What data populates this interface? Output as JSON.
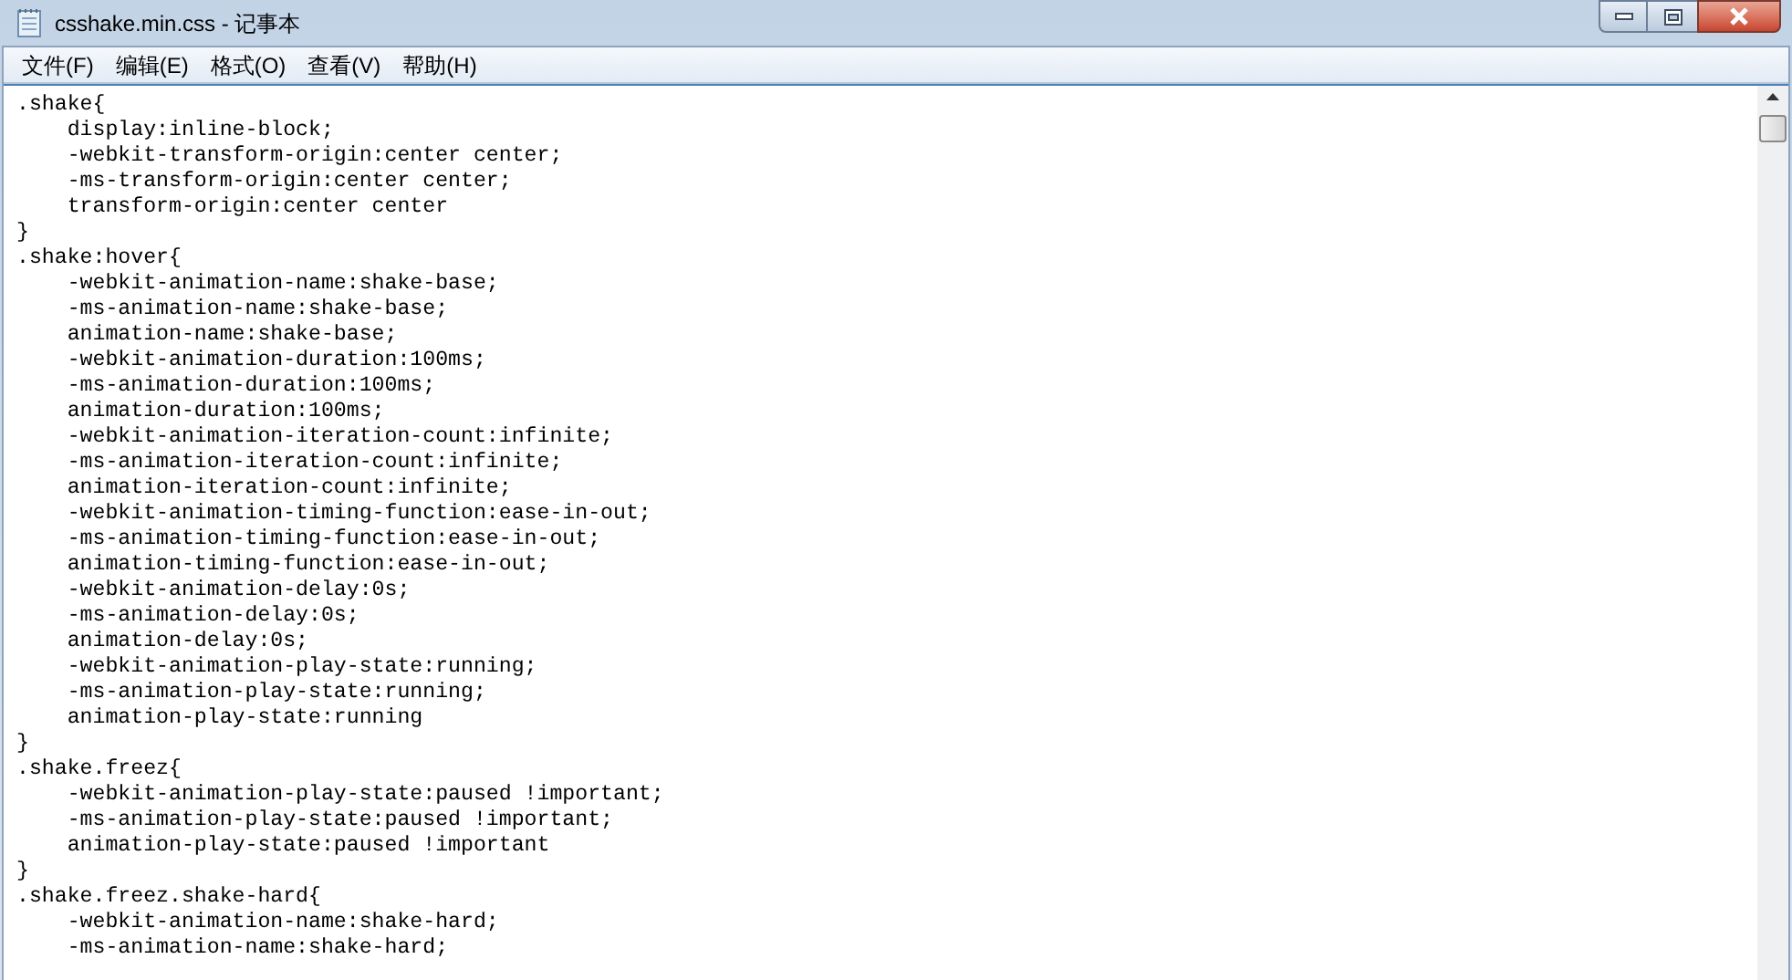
{
  "window": {
    "title": "csshake.min.css - 记事本"
  },
  "menu": [
    "文件(F)",
    "编辑(E)",
    "格式(O)",
    "查看(V)",
    "帮助(H)"
  ],
  "editor": {
    "lines": [
      ".shake{",
      "    display:inline-block;",
      "    -webkit-transform-origin:center center;",
      "    -ms-transform-origin:center center;",
      "    transform-origin:center center",
      "}",
      ".shake:hover{",
      "    -webkit-animation-name:shake-base;",
      "    -ms-animation-name:shake-base;",
      "    animation-name:shake-base;",
      "    -webkit-animation-duration:100ms;",
      "    -ms-animation-duration:100ms;",
      "    animation-duration:100ms;",
      "    -webkit-animation-iteration-count:infinite;",
      "    -ms-animation-iteration-count:infinite;",
      "    animation-iteration-count:infinite;",
      "    -webkit-animation-timing-function:ease-in-out;",
      "    -ms-animation-timing-function:ease-in-out;",
      "    animation-timing-function:ease-in-out;",
      "    -webkit-animation-delay:0s;",
      "    -ms-animation-delay:0s;",
      "    animation-delay:0s;",
      "    -webkit-animation-play-state:running;",
      "    -ms-animation-play-state:running;",
      "    animation-play-state:running",
      "}",
      ".shake.freez{",
      "    -webkit-animation-play-state:paused !important;",
      "    -ms-animation-play-state:paused !important;",
      "    animation-play-state:paused !important",
      "}",
      ".shake.freez.shake-hard{",
      "    -webkit-animation-name:shake-hard;",
      "    -ms-animation-name:shake-hard;"
    ]
  }
}
